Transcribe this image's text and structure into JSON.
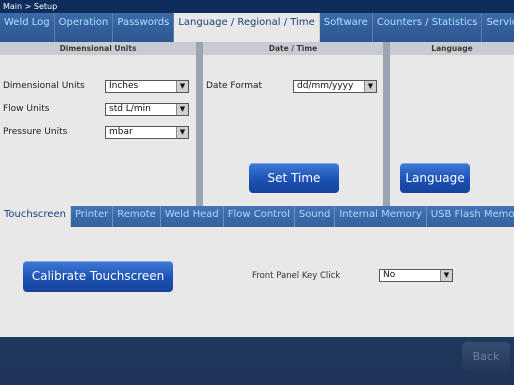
{
  "breadcrumb": "Main > Setup",
  "top_tabs": [
    {
      "label": "Weld Log"
    },
    {
      "label": "Operation"
    },
    {
      "label": "Passwords"
    },
    {
      "label": "Language / Regional / Time"
    },
    {
      "label": "Software"
    },
    {
      "label": "Counters / Statistics"
    },
    {
      "label": "Service"
    }
  ],
  "dimensional": {
    "heading": "Dimensional Units",
    "fields": [
      {
        "label": "Dimensional Units",
        "value": "Inches"
      },
      {
        "label": "Flow Units",
        "value": "std L/min"
      },
      {
        "label": "Pressure Units",
        "value": "mbar"
      }
    ]
  },
  "datetime": {
    "heading": "Date / Time",
    "date_format_label": "Date Format",
    "date_format_value": "dd/mm/yyyy",
    "set_time_label": "Set Time"
  },
  "language": {
    "heading": "Language",
    "button_label": "Language"
  },
  "sub_tabs": [
    {
      "label": "Touchscreen"
    },
    {
      "label": "Printer"
    },
    {
      "label": "Remote"
    },
    {
      "label": "Weld Head"
    },
    {
      "label": "Flow Control"
    },
    {
      "label": "Sound"
    },
    {
      "label": "Internal Memory"
    },
    {
      "label": "USB Flash Memory"
    }
  ],
  "touchscreen": {
    "calibrate_label": "Calibrate Touchscreen",
    "key_click_label": "Front Panel Key Click",
    "key_click_value": "No"
  },
  "back_label": "Back",
  "colors": {
    "active_tab_bg": "#e8e8e8",
    "inactive_tab_text": "#a9e2ff",
    "button_blue": "#1a4fb2"
  }
}
